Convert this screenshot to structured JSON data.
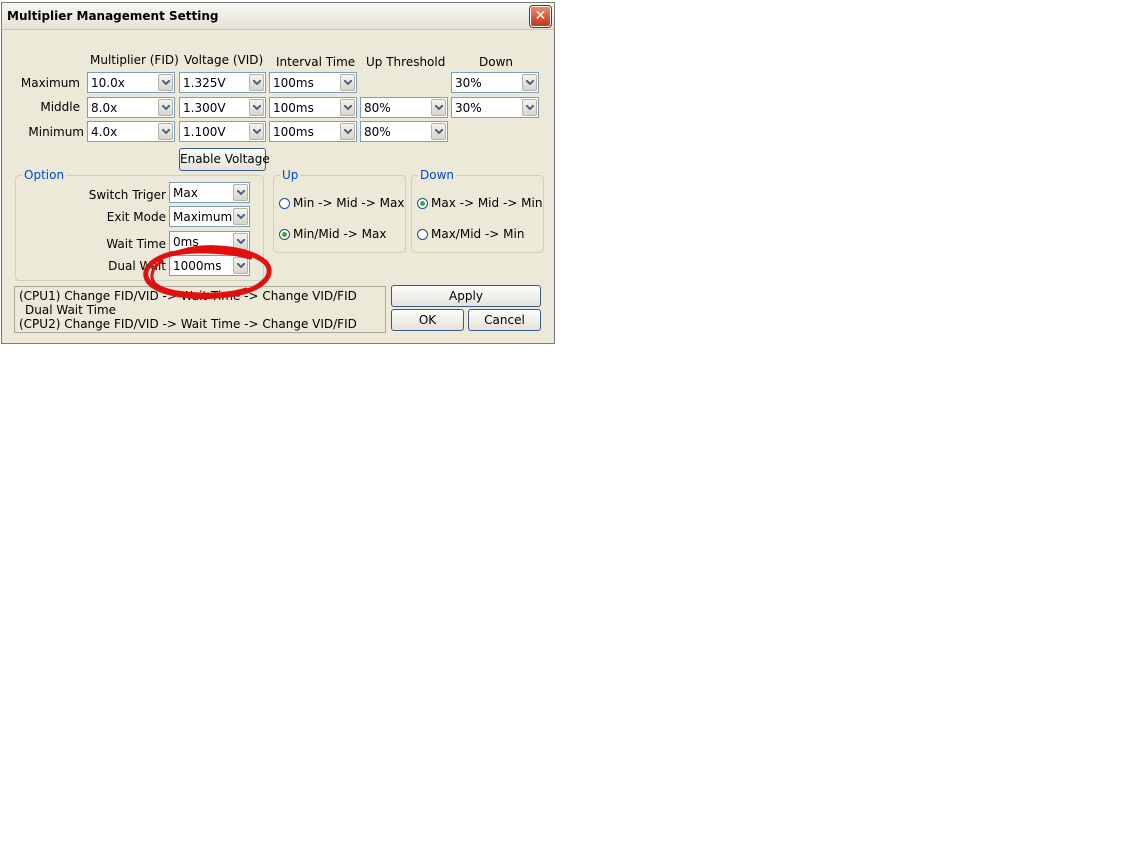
{
  "window": {
    "title": "Multiplier Management Setting"
  },
  "columns": {
    "multiplier": "Multiplier (FID)",
    "voltage": "Voltage (VID)",
    "interval": "Interval Time",
    "up_threshold": "Up Threshold",
    "down": "Down"
  },
  "rows": {
    "maximum": {
      "label": "Maximum",
      "fid": "10.0x",
      "vid": "1.325V",
      "interval": "100ms",
      "down": "30%"
    },
    "middle": {
      "label": "Middle",
      "fid": "8.0x",
      "vid": "1.300V",
      "interval": "100ms",
      "up": "80%",
      "down": "30%"
    },
    "minimum": {
      "label": "Minimum",
      "fid": "4.0x",
      "vid": "1.100V",
      "interval": "100ms",
      "up": "80%"
    }
  },
  "enable_voltage_label": "Enable Voltage",
  "option": {
    "title": "Option",
    "switch_trigger": {
      "label": "Switch Triger",
      "value": "Max"
    },
    "exit_mode": {
      "label": "Exit Mode",
      "value": "Maximum"
    },
    "wait_time": {
      "label": "Wait Time",
      "value": "0ms"
    },
    "dual_wait": {
      "label": "Dual Wait",
      "value": "1000ms"
    }
  },
  "up_group": {
    "title": "Up",
    "opt1": "Min -> Mid -> Max",
    "opt2": "Min/Mid -> Max",
    "selected": "opt2"
  },
  "down_group": {
    "title": "Down",
    "opt1": "Max -> Mid -> Min",
    "opt2": "Max/Mid -> Min",
    "selected": "opt1"
  },
  "info": {
    "line1": "(CPU1) Change FID/VID -> Wait Time -> Change VID/FID",
    "line2": "Dual Wait Time",
    "line3": "(CPU2) Change FID/VID -> Wait Time -> Change VID/FID"
  },
  "buttons": {
    "apply": "Apply",
    "ok": "OK",
    "cancel": "Cancel"
  },
  "annotation_color": "#e01010",
  "icons": {
    "close": "close-icon",
    "dropdown": "chevron-down-icon"
  }
}
